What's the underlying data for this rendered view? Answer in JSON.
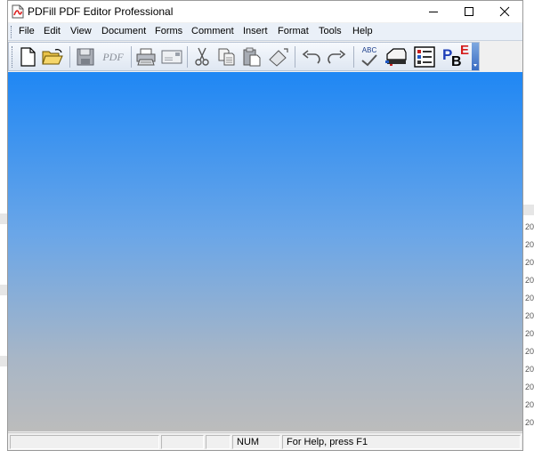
{
  "window": {
    "title": "PDFill PDF Editor Professional"
  },
  "menu": [
    "File",
    "Edit",
    "View",
    "Document",
    "Forms",
    "Comment",
    "Insert",
    "Format",
    "Tools",
    "Help"
  ],
  "toolbar": {
    "pdf_label": "PDF",
    "spell_label": "ABC",
    "pbe_p": "P",
    "pbe_b": "B",
    "pbe_e": "E"
  },
  "status": {
    "num": "NUM",
    "help": "For Help, press F1"
  },
  "background_app": {
    "right_marks": [
      "20",
      "20",
      "20",
      "20",
      "20",
      "20",
      "20",
      "20",
      "20",
      "20",
      "20",
      "20"
    ]
  },
  "colors": {
    "workspace_top": "#1f87f4",
    "workspace_bottom": "#bcbcbc",
    "menubar": "#eaf0f8"
  }
}
